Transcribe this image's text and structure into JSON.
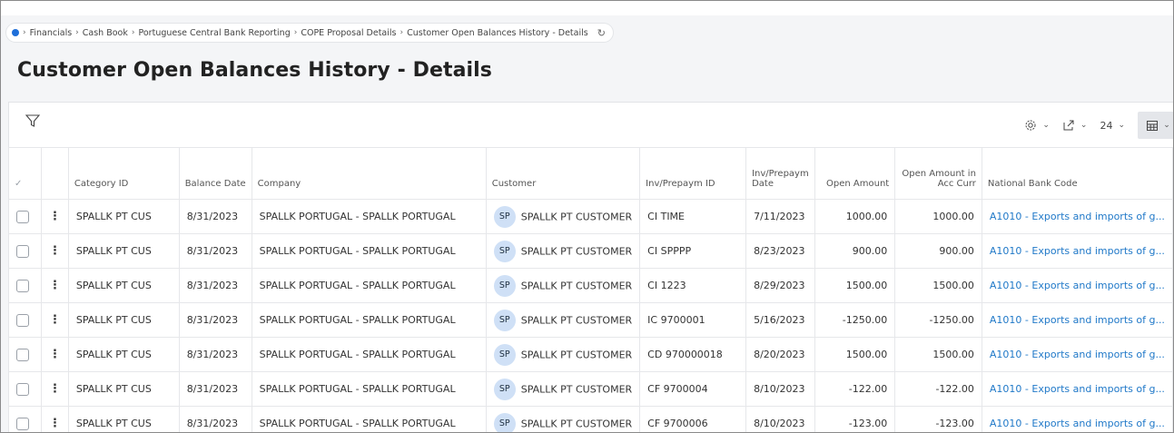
{
  "breadcrumb": {
    "items": [
      "Financials",
      "Cash Book",
      "Portuguese Central Bank Reporting",
      "COPE Proposal Details",
      "Customer Open Balances History - Details"
    ]
  },
  "page": {
    "title": "Customer Open Balances History - Details"
  },
  "toolbar": {
    "page_size": "24"
  },
  "table": {
    "columns": {
      "category_id": "Category ID",
      "balance_date": "Balance Date",
      "company": "Company",
      "customer": "Customer",
      "inv_id": "Inv/Prepaym ID",
      "inv_date_1": "Inv/Prepaym",
      "inv_date_2": "Date",
      "open_amount": "Open Amount",
      "open_acc_1": "Open Amount in",
      "open_acc_2": "Acc Curr",
      "national_bank_code": "National Bank Code"
    },
    "rows": [
      {
        "category_id": "SPALLK PT CUS",
        "balance_date": "8/31/2023",
        "company": "SPALLK PORTUGAL - SPALLK PORTUGAL",
        "customer_initials": "SP",
        "customer": "SPALLK PT CUSTOMER",
        "inv_id": "CI TIME",
        "inv_date": "7/11/2023",
        "open_amount": "1000.00",
        "open_acc": "1000.00",
        "nbc": "A1010 - Exports and imports of g..."
      },
      {
        "category_id": "SPALLK PT CUS",
        "balance_date": "8/31/2023",
        "company": "SPALLK PORTUGAL - SPALLK PORTUGAL",
        "customer_initials": "SP",
        "customer": "SPALLK PT CUSTOMER",
        "inv_id": "CI SPPPP",
        "inv_date": "8/23/2023",
        "open_amount": "900.00",
        "open_acc": "900.00",
        "nbc": "A1010 - Exports and imports of g..."
      },
      {
        "category_id": "SPALLK PT CUS",
        "balance_date": "8/31/2023",
        "company": "SPALLK PORTUGAL - SPALLK PORTUGAL",
        "customer_initials": "SP",
        "customer": "SPALLK PT CUSTOMER",
        "inv_id": "CI 1223",
        "inv_date": "8/29/2023",
        "open_amount": "1500.00",
        "open_acc": "1500.00",
        "nbc": "A1010 - Exports and imports of g..."
      },
      {
        "category_id": "SPALLK PT CUS",
        "balance_date": "8/31/2023",
        "company": "SPALLK PORTUGAL - SPALLK PORTUGAL",
        "customer_initials": "SP",
        "customer": "SPALLK PT CUSTOMER",
        "inv_id": "IC 9700001",
        "inv_date": "5/16/2023",
        "open_amount": "-1250.00",
        "open_acc": "-1250.00",
        "nbc": "A1010 - Exports and imports of g..."
      },
      {
        "category_id": "SPALLK PT CUS",
        "balance_date": "8/31/2023",
        "company": "SPALLK PORTUGAL - SPALLK PORTUGAL",
        "customer_initials": "SP",
        "customer": "SPALLK PT CUSTOMER",
        "inv_id": "CD 970000018",
        "inv_date": "8/20/2023",
        "open_amount": "1500.00",
        "open_acc": "1500.00",
        "nbc": "A1010 - Exports and imports of g..."
      },
      {
        "category_id": "SPALLK PT CUS",
        "balance_date": "8/31/2023",
        "company": "SPALLK PORTUGAL - SPALLK PORTUGAL",
        "customer_initials": "SP",
        "customer": "SPALLK PT CUSTOMER",
        "inv_id": "CF 9700004",
        "inv_date": "8/10/2023",
        "open_amount": "-122.00",
        "open_acc": "-122.00",
        "nbc": "A1010 - Exports and imports of g..."
      },
      {
        "category_id": "SPALLK PT CUS",
        "balance_date": "8/31/2023",
        "company": "SPALLK PORTUGAL - SPALLK PORTUGAL",
        "customer_initials": "SP",
        "customer": "SPALLK PT CUSTOMER",
        "inv_id": "CF 9700006",
        "inv_date": "8/10/2023",
        "open_amount": "-123.00",
        "open_acc": "-123.00",
        "nbc": "A1010 - Exports and imports of g..."
      }
    ]
  }
}
